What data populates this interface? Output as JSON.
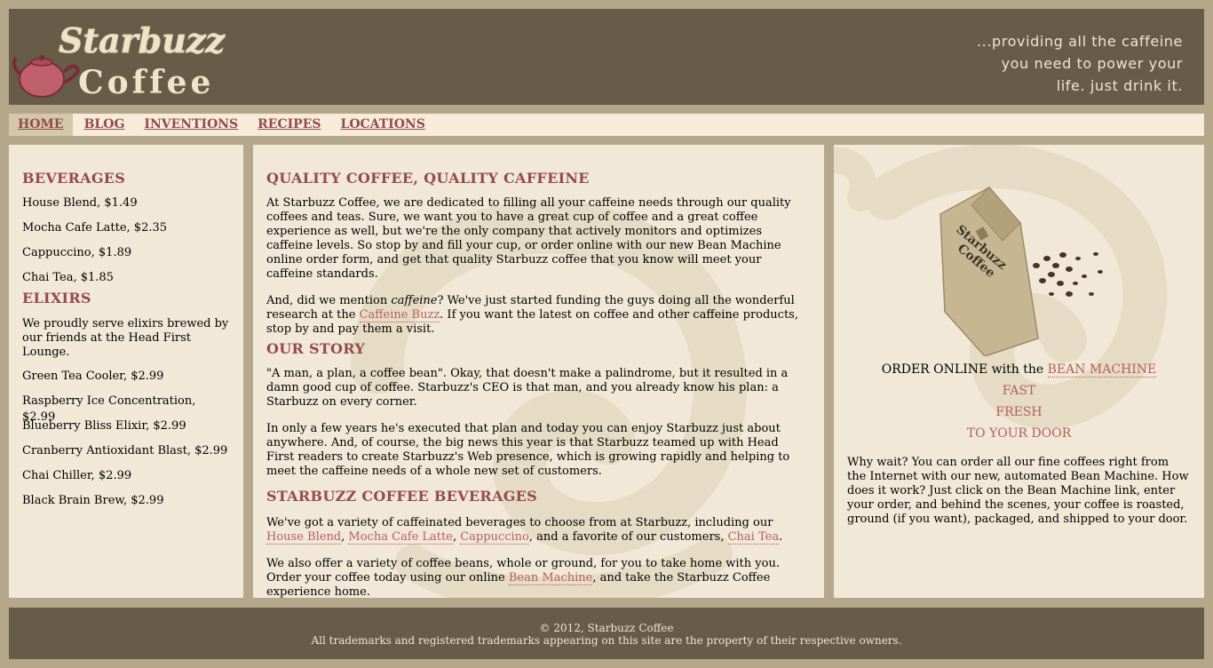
{
  "header": {
    "logo_word1": "Starbuzz",
    "logo_word2": "Coffee",
    "tagline": [
      "...providing all the caffeine",
      "you need to power your",
      "life. just drink it."
    ]
  },
  "nav": [
    "HOME",
    "BLOG",
    "INVENTIONS",
    "RECIPES",
    "LOCATIONS"
  ],
  "sidebar": {
    "beverages_title": "BEVERAGES",
    "beverages": [
      "House Blend, $1.49",
      "Mocha Cafe Latte, $2.35",
      "Cappuccino, $1.89",
      "Chai Tea, $1.85"
    ],
    "elixirs_title": "ELIXIRS",
    "elixirs_intro": "We proudly serve elixirs brewed by our friends at the Head First Lounge.",
    "elixirs": [
      "Green Tea Cooler, $2.99",
      "Raspberry Ice Concentration, $2.99",
      "Blueberry Bliss Elixir, $2.99",
      "Cranberry Antioxidant Blast, $2.99",
      "Chai Chiller, $2.99",
      "Black Brain Brew, $2.99"
    ]
  },
  "main": {
    "h1": "QUALITY COFFEE, QUALITY CAFFEINE",
    "p1": "At Starbuzz Coffee, we are dedicated to filling all your caffeine needs through our quality coffees and teas. Sure, we want you to have a great cup of coffee and a great coffee experience as well, but we're the only company that actively monitors and optimizes caffeine levels. So stop by and fill your cup, or order online with our new Bean Machine online order form, and get that quality Starbuzz coffee that you know will meet your caffeine standards.",
    "p2_a": "And, did we mention ",
    "p2_em": "caffeine",
    "p2_b": "? We've just started funding the guys doing all the wonderful research at the ",
    "p2_link": "Caffeine Buzz",
    "p2_c": ". If you want the latest on coffee and other caffeine products, stop by and pay them a visit.",
    "h2": "OUR STORY",
    "p3": "\"A man, a plan, a coffee bean\". Okay, that doesn't make a palindrome, but it resulted in a damn good cup of coffee. Starbuzz's CEO is that man, and you already know his plan: a Starbuzz on every corner.",
    "p4": "In only a few years he's executed that plan and today you can enjoy Starbuzz just about anywhere. And, of course, the big news this year is that Starbuzz teamed up with Head First readers to create Starbuzz's Web presence, which is growing rapidly and helping to meet the caffeine needs of a whole new set of customers.",
    "h3": "STARBUZZ COFFEE BEVERAGES",
    "p5_a": "We've got a variety of caffeinated beverages to choose from at Starbuzz, including our ",
    "p5_l1": "House Blend",
    "p5_s1": ", ",
    "p5_l2": "Mocha Cafe Latte",
    "p5_s2": ", ",
    "p5_l3": "Cappuccino",
    "p5_b": ", and a favorite of our customers, ",
    "p5_l4": "Chai Tea",
    "p5_c": ".",
    "p6_a": "We also offer a variety of coffee beans, whole or ground, for you to take home with you. Order your coffee today using our online ",
    "p6_link": "Bean Machine",
    "p6_b": ", and take the Starbuzz Coffee experience home."
  },
  "aside": {
    "bag_text1": "Starbuzz",
    "bag_text2": "Coffee",
    "order_text": "ORDER ONLINE with the ",
    "order_link": "BEAN MACHINE",
    "line_fast": "FAST",
    "line_fresh": "FRESH",
    "line_door": "TO YOUR DOOR",
    "para": "Why wait? You can order all our fine coffees right from the Internet with our new, automated Bean Machine. How does it work? Just click on the Bean Machine link, enter your order, and behind the scenes, your coffee is roasted, ground (if you want), packaged, and shipped to your door."
  },
  "footer": {
    "copyright": "© 2012, Starbuzz Coffee",
    "trademarks": "All trademarks and registered trademarks appearing on this site are the property of their respective owners."
  }
}
